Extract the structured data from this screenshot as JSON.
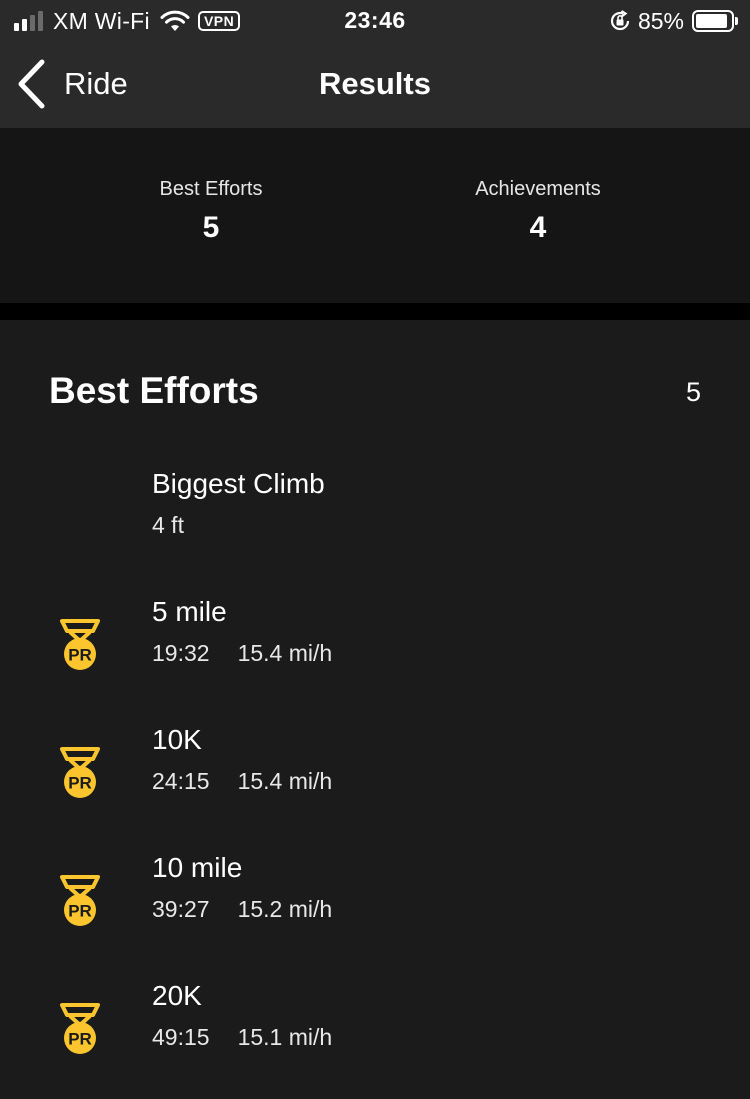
{
  "status_bar": {
    "carrier": "XM Wi-Fi",
    "vpn": "VPN",
    "time": "23:46",
    "battery_percent": "85%",
    "battery_level": 0.85,
    "signal_bars": 2,
    "icons": [
      "signal-icon",
      "wifi-icon",
      "orientation-lock-icon",
      "battery-icon"
    ]
  },
  "nav": {
    "back_label": "Ride",
    "title": "Results"
  },
  "summary": {
    "best_efforts_label": "Best Efforts",
    "best_efforts_value": "5",
    "achievements_label": "Achievements",
    "achievements_value": "4"
  },
  "best_efforts": {
    "title": "Best Efforts",
    "count": "5",
    "items": [
      {
        "name": "Biggest Climb",
        "time": "4 ft",
        "speed": "",
        "pr": false
      },
      {
        "name": "5 mile",
        "time": "19:32",
        "speed": "15.4 mi/h",
        "pr": true,
        "badge": "PR"
      },
      {
        "name": "10K",
        "time": "24:15",
        "speed": "15.4 mi/h",
        "pr": true,
        "badge": "PR"
      },
      {
        "name": "10 mile",
        "time": "39:27",
        "speed": "15.2 mi/h",
        "pr": true,
        "badge": "PR"
      },
      {
        "name": "20K",
        "time": "49:15",
        "speed": "15.1 mi/h",
        "pr": true,
        "badge": "PR"
      }
    ]
  },
  "colors": {
    "background": "#000000",
    "bars": "#2a2a2a",
    "summary_bg": "#151515",
    "section_bg": "#1b1b1b",
    "medal": "#fcc52e",
    "text": "#ffffff"
  }
}
